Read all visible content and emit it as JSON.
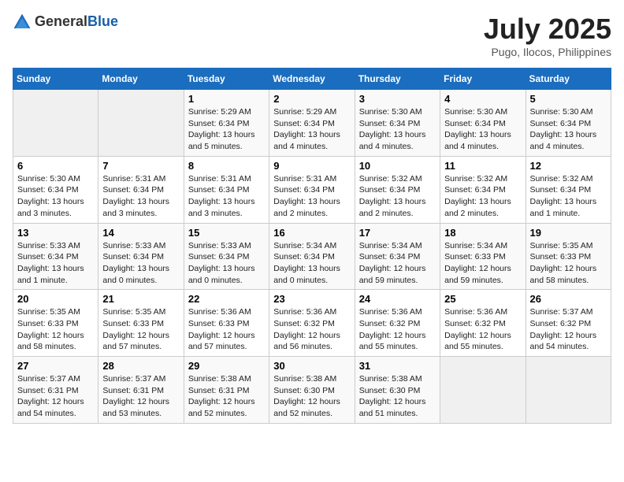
{
  "logo": {
    "general": "General",
    "blue": "Blue"
  },
  "title": "July 2025",
  "location": "Pugo, Ilocos, Philippines",
  "weekdays": [
    "Sunday",
    "Monday",
    "Tuesday",
    "Wednesday",
    "Thursday",
    "Friday",
    "Saturday"
  ],
  "weeks": [
    [
      {
        "day": "",
        "info": ""
      },
      {
        "day": "",
        "info": ""
      },
      {
        "day": "1",
        "info": "Sunrise: 5:29 AM\nSunset: 6:34 PM\nDaylight: 13 hours and 5 minutes."
      },
      {
        "day": "2",
        "info": "Sunrise: 5:29 AM\nSunset: 6:34 PM\nDaylight: 13 hours and 4 minutes."
      },
      {
        "day": "3",
        "info": "Sunrise: 5:30 AM\nSunset: 6:34 PM\nDaylight: 13 hours and 4 minutes."
      },
      {
        "day": "4",
        "info": "Sunrise: 5:30 AM\nSunset: 6:34 PM\nDaylight: 13 hours and 4 minutes."
      },
      {
        "day": "5",
        "info": "Sunrise: 5:30 AM\nSunset: 6:34 PM\nDaylight: 13 hours and 4 minutes."
      }
    ],
    [
      {
        "day": "6",
        "info": "Sunrise: 5:30 AM\nSunset: 6:34 PM\nDaylight: 13 hours and 3 minutes."
      },
      {
        "day": "7",
        "info": "Sunrise: 5:31 AM\nSunset: 6:34 PM\nDaylight: 13 hours and 3 minutes."
      },
      {
        "day": "8",
        "info": "Sunrise: 5:31 AM\nSunset: 6:34 PM\nDaylight: 13 hours and 3 minutes."
      },
      {
        "day": "9",
        "info": "Sunrise: 5:31 AM\nSunset: 6:34 PM\nDaylight: 13 hours and 2 minutes."
      },
      {
        "day": "10",
        "info": "Sunrise: 5:32 AM\nSunset: 6:34 PM\nDaylight: 13 hours and 2 minutes."
      },
      {
        "day": "11",
        "info": "Sunrise: 5:32 AM\nSunset: 6:34 PM\nDaylight: 13 hours and 2 minutes."
      },
      {
        "day": "12",
        "info": "Sunrise: 5:32 AM\nSunset: 6:34 PM\nDaylight: 13 hours and 1 minute."
      }
    ],
    [
      {
        "day": "13",
        "info": "Sunrise: 5:33 AM\nSunset: 6:34 PM\nDaylight: 13 hours and 1 minute."
      },
      {
        "day": "14",
        "info": "Sunrise: 5:33 AM\nSunset: 6:34 PM\nDaylight: 13 hours and 0 minutes."
      },
      {
        "day": "15",
        "info": "Sunrise: 5:33 AM\nSunset: 6:34 PM\nDaylight: 13 hours and 0 minutes."
      },
      {
        "day": "16",
        "info": "Sunrise: 5:34 AM\nSunset: 6:34 PM\nDaylight: 13 hours and 0 minutes."
      },
      {
        "day": "17",
        "info": "Sunrise: 5:34 AM\nSunset: 6:34 PM\nDaylight: 12 hours and 59 minutes."
      },
      {
        "day": "18",
        "info": "Sunrise: 5:34 AM\nSunset: 6:33 PM\nDaylight: 12 hours and 59 minutes."
      },
      {
        "day": "19",
        "info": "Sunrise: 5:35 AM\nSunset: 6:33 PM\nDaylight: 12 hours and 58 minutes."
      }
    ],
    [
      {
        "day": "20",
        "info": "Sunrise: 5:35 AM\nSunset: 6:33 PM\nDaylight: 12 hours and 58 minutes."
      },
      {
        "day": "21",
        "info": "Sunrise: 5:35 AM\nSunset: 6:33 PM\nDaylight: 12 hours and 57 minutes."
      },
      {
        "day": "22",
        "info": "Sunrise: 5:36 AM\nSunset: 6:33 PM\nDaylight: 12 hours and 57 minutes."
      },
      {
        "day": "23",
        "info": "Sunrise: 5:36 AM\nSunset: 6:32 PM\nDaylight: 12 hours and 56 minutes."
      },
      {
        "day": "24",
        "info": "Sunrise: 5:36 AM\nSunset: 6:32 PM\nDaylight: 12 hours and 55 minutes."
      },
      {
        "day": "25",
        "info": "Sunrise: 5:36 AM\nSunset: 6:32 PM\nDaylight: 12 hours and 55 minutes."
      },
      {
        "day": "26",
        "info": "Sunrise: 5:37 AM\nSunset: 6:32 PM\nDaylight: 12 hours and 54 minutes."
      }
    ],
    [
      {
        "day": "27",
        "info": "Sunrise: 5:37 AM\nSunset: 6:31 PM\nDaylight: 12 hours and 54 minutes."
      },
      {
        "day": "28",
        "info": "Sunrise: 5:37 AM\nSunset: 6:31 PM\nDaylight: 12 hours and 53 minutes."
      },
      {
        "day": "29",
        "info": "Sunrise: 5:38 AM\nSunset: 6:31 PM\nDaylight: 12 hours and 52 minutes."
      },
      {
        "day": "30",
        "info": "Sunrise: 5:38 AM\nSunset: 6:30 PM\nDaylight: 12 hours and 52 minutes."
      },
      {
        "day": "31",
        "info": "Sunrise: 5:38 AM\nSunset: 6:30 PM\nDaylight: 12 hours and 51 minutes."
      },
      {
        "day": "",
        "info": ""
      },
      {
        "day": "",
        "info": ""
      }
    ]
  ]
}
